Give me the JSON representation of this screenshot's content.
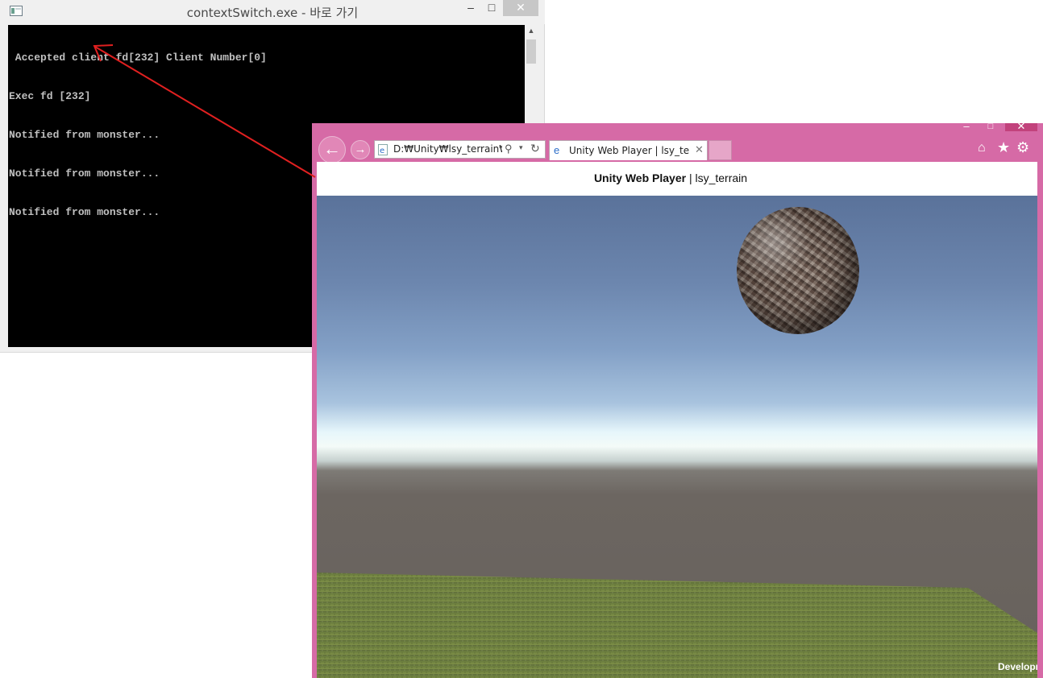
{
  "console_window": {
    "title": "contextSwitch.exe - 바로 가기",
    "controls": {
      "minimize": "–",
      "maximize": "□",
      "close": "✕"
    },
    "lines": [
      " Accepted client fd[232] Client Number[0]",
      "Exec fd [232]",
      "Notified from monster...",
      "Notified from monster...",
      "Notified from monster..."
    ],
    "scroll_up": "▲"
  },
  "annotation": {
    "arrow_color": "#e02020"
  },
  "browser_window": {
    "frame_color": "#d66aa6",
    "controls": {
      "minimize": "–",
      "maximize": "□",
      "close": "✕"
    },
    "nav": {
      "back": "←",
      "forward": "→"
    },
    "address": {
      "value": "D:₩Unity₩lsy_terrain₩we",
      "page_icon": "ie-page-icon",
      "search_glyph": "⚲",
      "dropdown_glyph": "▾",
      "refresh_glyph": "↻"
    },
    "tab": {
      "title": "Unity Web Player | lsy_terrain...",
      "favicon": "e",
      "close": "✕"
    },
    "toolbar": {
      "home": "⌂",
      "favorites": "★",
      "settings": "⚙"
    },
    "page": {
      "heading_bold": "Unity Web Player",
      "heading_rest": " | lsy_terrain",
      "developer_label": "Development Build"
    }
  }
}
